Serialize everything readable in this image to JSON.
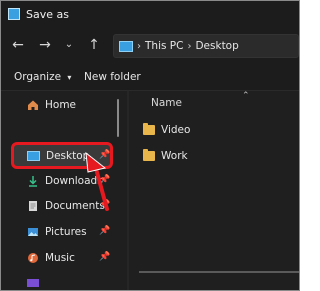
{
  "window": {
    "title": "Save as"
  },
  "toolbar": {
    "back_icon": "arrow-left-icon",
    "forward_icon": "arrow-right-icon",
    "recent_icon": "chevron-down-icon",
    "up_icon": "arrow-up-icon",
    "breadcrumb": [
      "This PC",
      "Desktop"
    ]
  },
  "commands": {
    "organize": "Organize",
    "new_folder": "New folder"
  },
  "sidebar": {
    "items": [
      {
        "label": "Home",
        "icon": "home-icon",
        "pinned": false
      },
      {
        "label": "Desktop",
        "icon": "desktop-icon",
        "pinned": true,
        "selected": true
      },
      {
        "label": "Downloads",
        "icon": "download-icon",
        "pinned": true
      },
      {
        "label": "Documents",
        "icon": "documents-icon",
        "pinned": true
      },
      {
        "label": "Pictures",
        "icon": "pictures-icon",
        "pinned": true
      },
      {
        "label": "Music",
        "icon": "music-icon",
        "pinned": true
      }
    ]
  },
  "content": {
    "column_header": "Name",
    "files": [
      {
        "name": "Video",
        "icon": "folder-icon"
      },
      {
        "name": "Work",
        "icon": "folder-icon"
      }
    ]
  },
  "colors": {
    "highlight": "#e5191f",
    "background": "#1f1f1f",
    "folder": "#e8b64a",
    "accent": "#3a9fe0"
  }
}
